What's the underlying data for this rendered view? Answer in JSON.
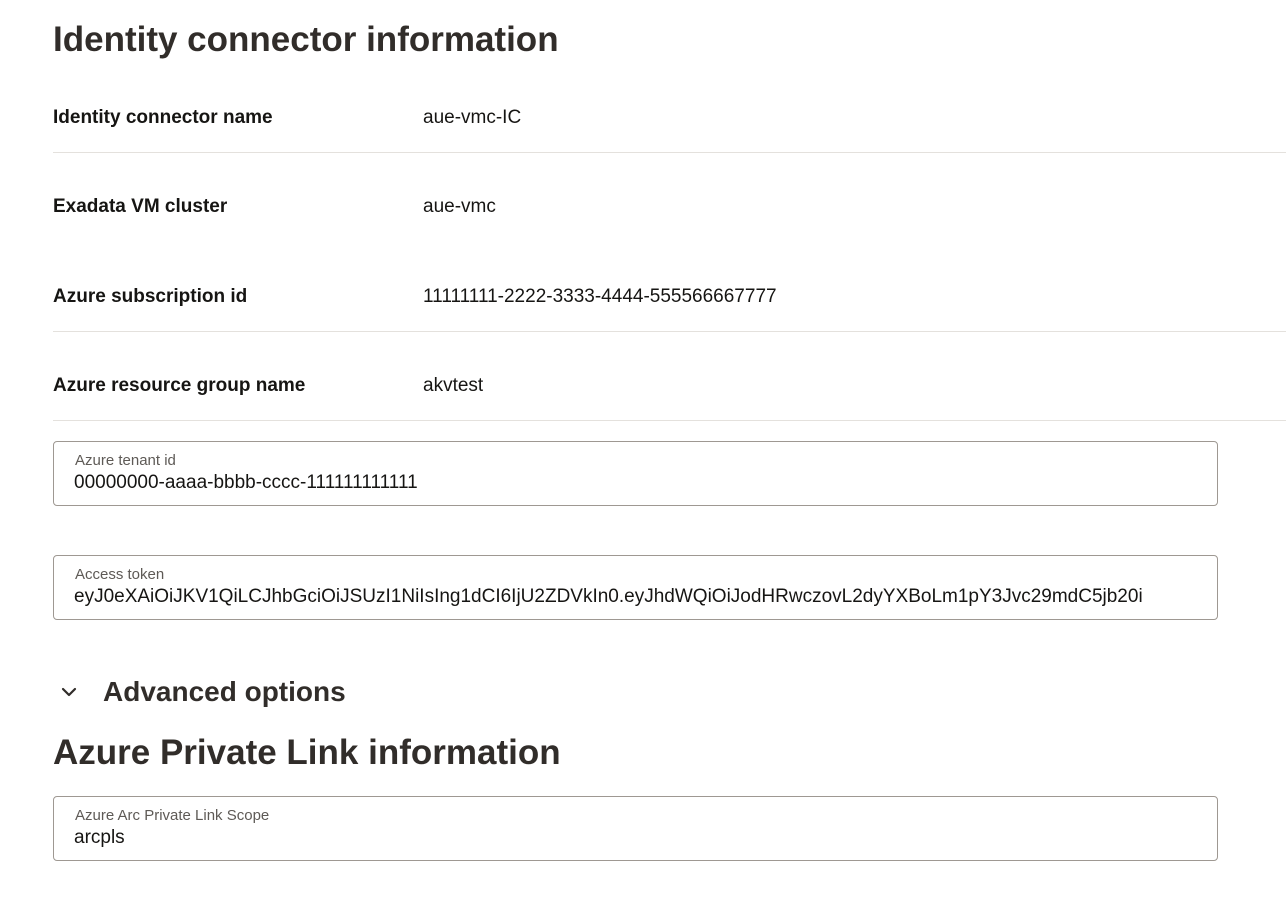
{
  "identity_section": {
    "title": "Identity connector information",
    "rows": [
      {
        "label": "Identity connector name",
        "value": "aue-vmc-IC"
      },
      {
        "label": "Exadata VM cluster",
        "value": "aue-vmc"
      },
      {
        "label": "Azure subscription id",
        "value": "11111111-2222-3333-4444-555566667777"
      },
      {
        "label": "Azure resource group name",
        "value": "akvtest"
      }
    ],
    "tenant_field": {
      "label": "Azure tenant id",
      "value": "00000000-aaaa-bbbb-cccc-111111111111"
    },
    "token_field": {
      "label": "Access token",
      "value": "eyJ0eXAiOiJKV1QiLCJhbGciOiJSUzI1NiIsIng1dCI6IjU2ZDVkIn0.eyJhdWQiOiJodHRwczovL2dyYXBoLm1pY3Jvc29mdC5jb20i"
    }
  },
  "advanced_options": {
    "label": "Advanced options",
    "icon": "chevron-down-icon",
    "expanded": true
  },
  "private_link_section": {
    "title": "Azure Private Link information",
    "arc_field": {
      "label": "Azure Arc Private Link Scope",
      "value": "arcpls"
    }
  }
}
